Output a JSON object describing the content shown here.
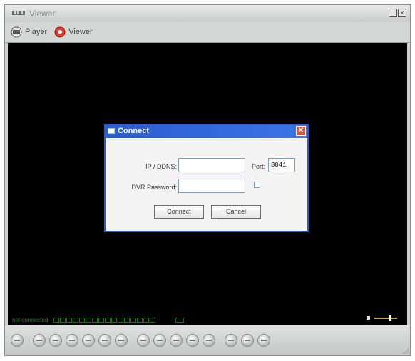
{
  "window": {
    "title": "Viewer",
    "controls": [
      "minimize",
      "close"
    ]
  },
  "toolbar": {
    "player_label": "Player",
    "viewer_label": "Viewer"
  },
  "status": {
    "connection_text": "not connected"
  },
  "dialog": {
    "title": "Connect",
    "ip_label": "IP / DDNS:",
    "ip_value": "",
    "port_label": "Port:",
    "port_value": "8041",
    "password_label": "DVR Password:",
    "password_value": "",
    "connect_button": "Connect",
    "cancel_button": "Cancel"
  },
  "colors": {
    "dialog_title_bg": "#2a5bd0",
    "video_bg": "#000000",
    "status_text": "#2f7a2f"
  }
}
